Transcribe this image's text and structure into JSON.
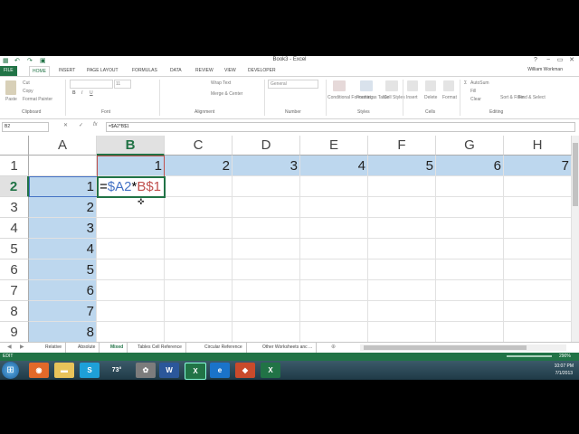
{
  "window": {
    "title": "Book3 - Excel",
    "user": "William Workman",
    "controls": [
      "?",
      "−",
      "▭",
      "✕"
    ]
  },
  "ribbon_tabs": [
    "FILE",
    "HOME",
    "INSERT",
    "PAGE LAYOUT",
    "FORMULAS",
    "DATA",
    "REVIEW",
    "VIEW",
    "DEVELOPER"
  ],
  "ribbon": {
    "clipboard": {
      "cut": "Cut",
      "copy": "Copy",
      "format_painter": "Format Painter",
      "paste": "Paste",
      "group": "Clipboard"
    },
    "font": {
      "size": "11",
      "group": "Font"
    },
    "alignment": {
      "wrap": "Wrap Text",
      "merge": "Merge & Center",
      "group": "Alignment"
    },
    "number": {
      "format": "General",
      "group": "Number"
    },
    "styles": {
      "conditional": "Conditional Formatting",
      "format_table": "Format as Table",
      "cell_styles": "Cell Styles",
      "group": "Styles"
    },
    "cells": {
      "insert": "Insert",
      "delete": "Delete",
      "format": "Format",
      "group": "Cells"
    },
    "editing": {
      "autosum": "AutoSum",
      "fill": "Fill",
      "clear": "Clear",
      "sort": "Sort & Filter",
      "find": "Find & Select",
      "group": "Editing"
    }
  },
  "formula_bar": {
    "name_box": "B2",
    "cancel": "✕",
    "enter": "✓",
    "fx": "fx",
    "formula": "=$A2*B$1"
  },
  "columns": [
    "A",
    "B",
    "C",
    "D",
    "E",
    "F",
    "G",
    "H"
  ],
  "rows": [
    "1",
    "2",
    "3",
    "4",
    "5",
    "6",
    "7",
    "8",
    "9"
  ],
  "cells": {
    "row1": [
      "",
      "1",
      "2",
      "3",
      "4",
      "5",
      "6",
      "7"
    ],
    "colA": [
      "",
      "1",
      "2",
      "3",
      "4",
      "5",
      "6",
      "7",
      "8"
    ]
  },
  "active_cell": {
    "eq": "=",
    "ref_a": "$A2",
    "op": "*",
    "ref_b": "B$1"
  },
  "sheet_tabs": [
    "Relative",
    "Absolute",
    "Mixed",
    "Tables Cell Reference",
    "Circular Reference",
    "Other Worksheets anc ..."
  ],
  "active_sheet": "Mixed",
  "status": {
    "mode": "EDIT",
    "zoom": "290%"
  },
  "taskbar": {
    "weather": "73°",
    "time": "10:07 PM",
    "date": "7/1/2013"
  }
}
